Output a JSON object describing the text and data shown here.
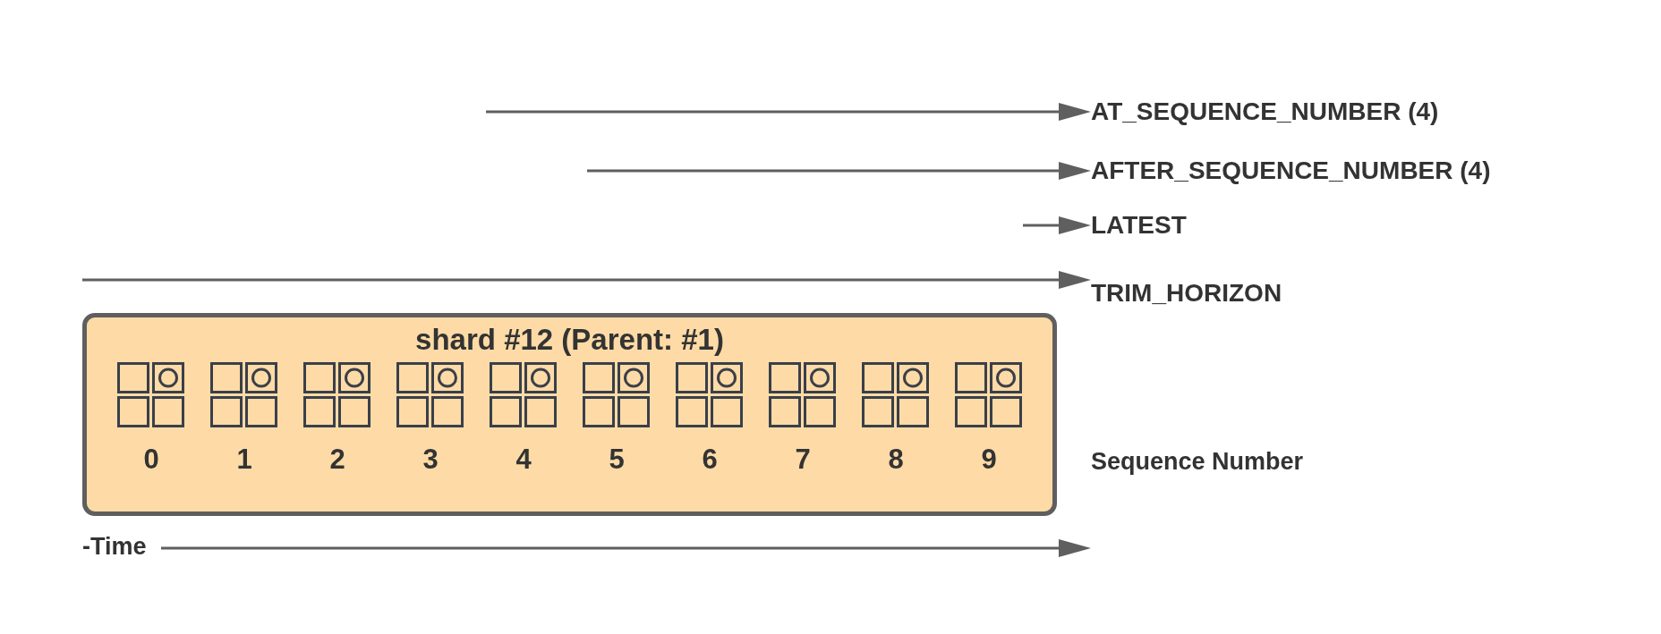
{
  "pointers": [
    {
      "label": "AT_SEQUENCE_NUMBER (4)"
    },
    {
      "label": "AFTER_SEQUENCE_NUMBER (4)"
    },
    {
      "label": "LATEST"
    },
    {
      "label": "TRIM_HORIZON"
    }
  ],
  "shard": {
    "title": "shard #12 (Parent: #1)",
    "records": [
      {
        "label": "0"
      },
      {
        "label": "1"
      },
      {
        "label": "2"
      },
      {
        "label": "3"
      },
      {
        "label": "4"
      },
      {
        "label": "5"
      },
      {
        "label": "6"
      },
      {
        "label": "7"
      },
      {
        "label": "8"
      },
      {
        "label": "9"
      }
    ]
  },
  "axis_label": "Sequence Number",
  "time_label": "-Time"
}
